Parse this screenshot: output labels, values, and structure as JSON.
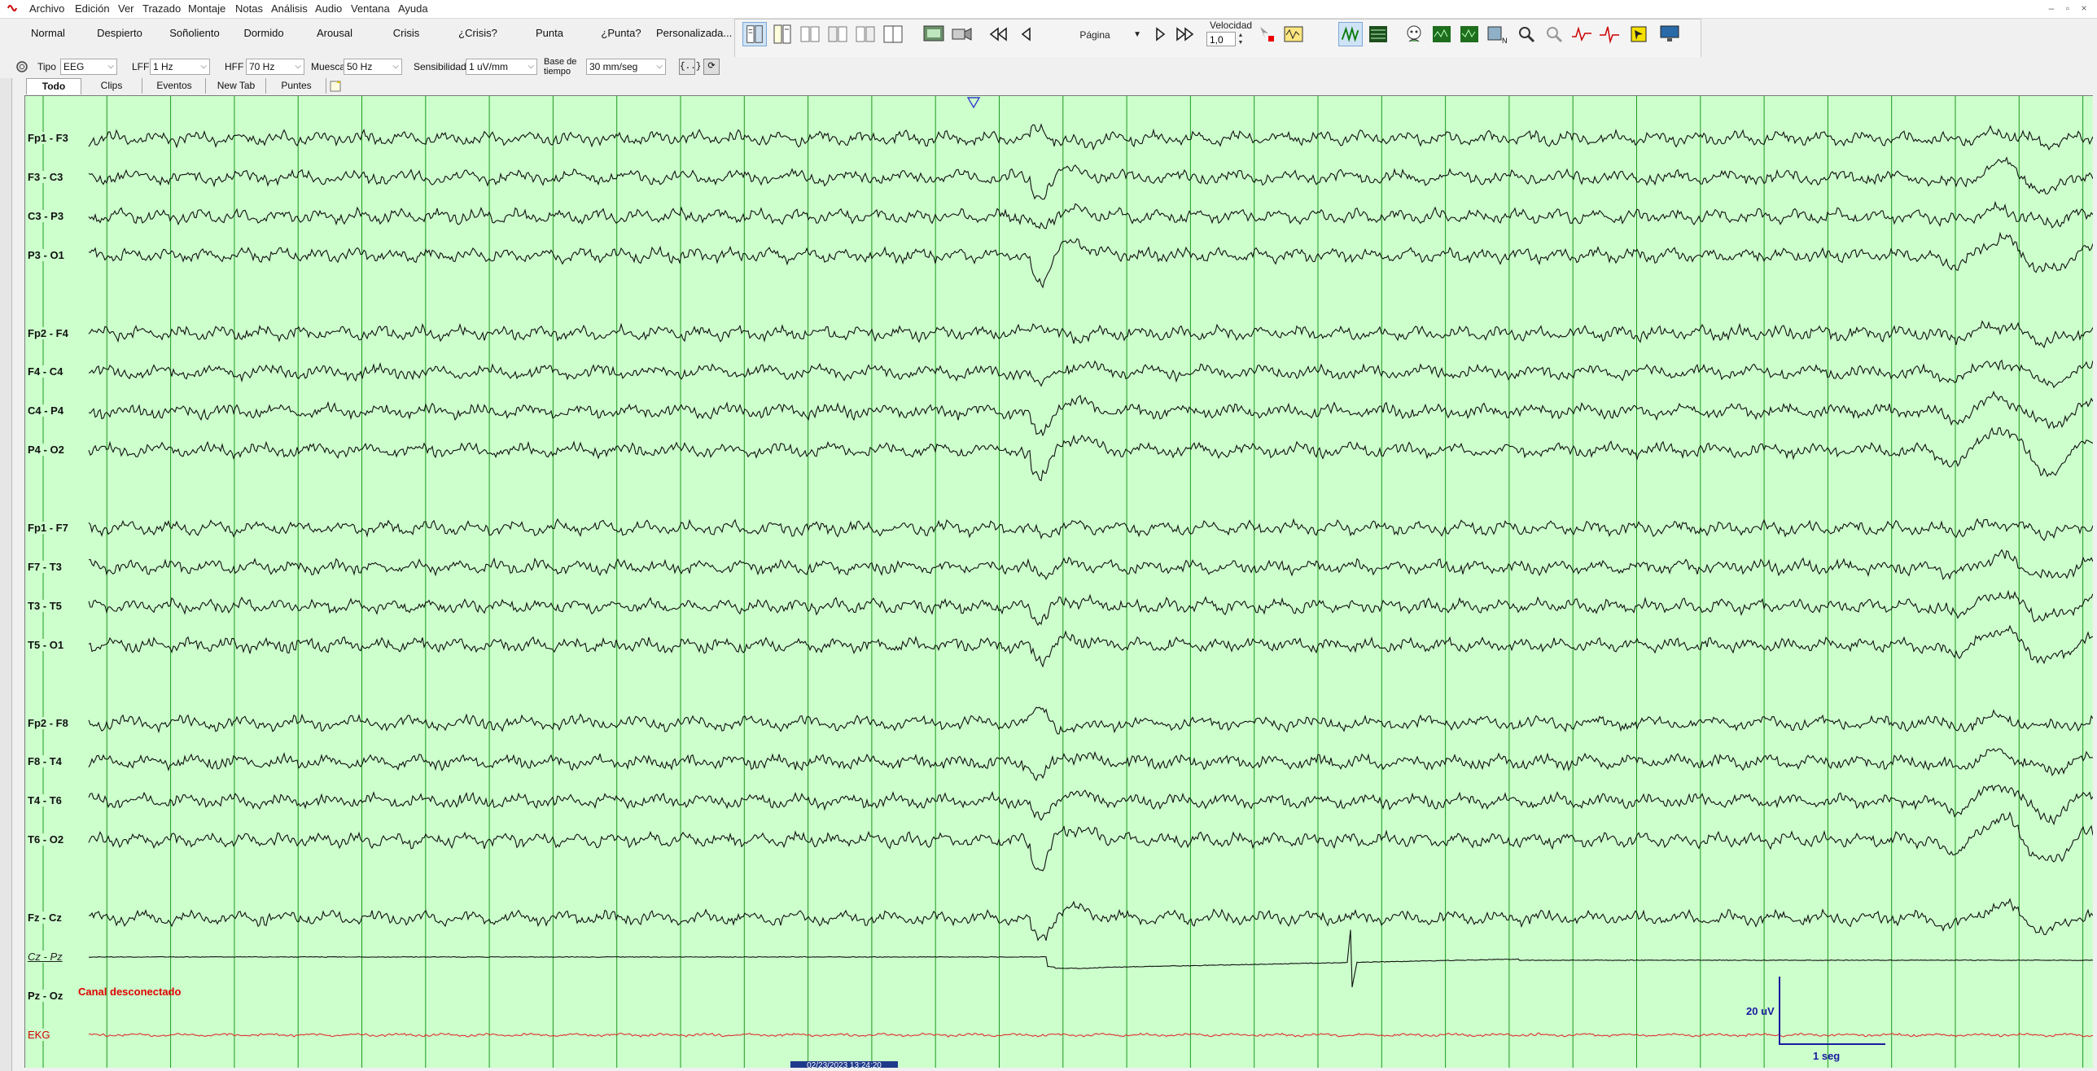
{
  "menu": {
    "items": [
      "Archivo",
      "Edición",
      "Ver",
      "Trazado",
      "Montaje",
      "Notas",
      "Análisis",
      "Audio",
      "Ventana",
      "Ayuda"
    ],
    "window_controls": [
      "–",
      "▫",
      "×"
    ]
  },
  "states": [
    "Normal",
    "Despierto",
    "Soñoliento",
    "Dormido",
    "Arousal",
    "Crisis",
    "¿Crisis?",
    "Punta",
    "¿Punta?",
    "Personalizada..."
  ],
  "toolbar": {
    "page_select": "Página",
    "velocity_label": "Velocidad",
    "velocity_value": "1,0"
  },
  "filters": {
    "tipo_label": "Tipo",
    "tipo_value": "EEG",
    "lff_label": "LFF",
    "lff_value": "1 Hz",
    "hff_label": "HFF",
    "hff_value": "70 Hz",
    "muesca_label": "Muesca",
    "muesca_value": "50 Hz",
    "sensibilidad_label": "Sensibilidad",
    "sensibilidad_value": "1 uV/mm",
    "base_label_1": "Base de",
    "base_label_2": "tiempo",
    "base_value": "30 mm/seg",
    "btn_braces": "{..}",
    "btn_refresh": "⟳"
  },
  "tabs": [
    "Todo",
    "Clips",
    "Eventos",
    "New Tab",
    "Puntes"
  ],
  "channels": [
    {
      "label": "Fp1 - F3",
      "style": "normal"
    },
    {
      "label": "F3 - C3",
      "style": "normal"
    },
    {
      "label": "C3 - P3",
      "style": "normal"
    },
    {
      "label": "P3 - O1",
      "style": "normal"
    },
    {
      "label": "Fp2 - F4",
      "style": "normal"
    },
    {
      "label": "F4 - C4",
      "style": "normal"
    },
    {
      "label": "C4 - P4",
      "style": "normal"
    },
    {
      "label": "P4 - O2",
      "style": "normal"
    },
    {
      "label": "Fp1 - F7",
      "style": "normal"
    },
    {
      "label": "F7 - T3",
      "style": "normal"
    },
    {
      "label": "T3 - T5",
      "style": "normal"
    },
    {
      "label": "T5 - O1",
      "style": "normal"
    },
    {
      "label": "Fp2 - F8",
      "style": "normal"
    },
    {
      "label": "F8 - T4",
      "style": "normal"
    },
    {
      "label": "T4 - T6",
      "style": "normal"
    },
    {
      "label": "T6 - O2",
      "style": "normal"
    },
    {
      "label": "Fz - Cz",
      "style": "normal"
    },
    {
      "label": "Cz - Pz",
      "style": "italic"
    },
    {
      "label": "Pz - Oz",
      "style": "normal"
    },
    {
      "label": "EKG",
      "style": "red"
    }
  ],
  "disconnected_text": "Canal desconectado",
  "scale": {
    "amplitude": "20 uV",
    "time": "1 seg"
  },
  "timestamp": "02/23/2023 13:24:20",
  "colors": {
    "background": "#ccffcc",
    "trace": "#111111",
    "ekg": "#e03030",
    "gridline": "#1f9a1f",
    "scale_bar": "#1a1aa0"
  }
}
